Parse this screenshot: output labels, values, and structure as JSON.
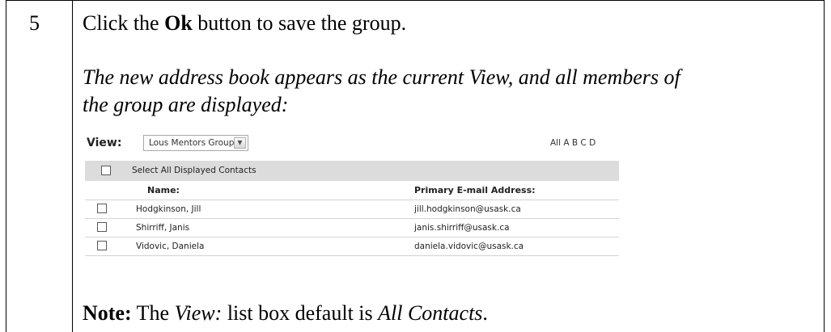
{
  "step": {
    "number": "5",
    "instruction": {
      "before": "Click the ",
      "bold": "Ok",
      "after": " button to save the group."
    },
    "description_line1": "The new address book appears as the current View, and all members of",
    "description_line2": "the group are displayed:",
    "note": {
      "label": "Note:",
      "pre": " The ",
      "italic1": "View:",
      "mid": " list box default is ",
      "italic2": "All Contacts",
      "post": "."
    }
  },
  "screenshot": {
    "view_label": "View:",
    "view_selected": "Lous Mentors Group",
    "alpha_filter": "All A B C D",
    "select_all_label": "Select All Displayed Contacts",
    "columns": {
      "name": "Name:",
      "email": "Primary E-mail Address:"
    },
    "contacts": [
      {
        "name": "Hodgkinson, Jill",
        "email": "jill.hodgkinson@usask.ca"
      },
      {
        "name": "Shirriff, Janis",
        "email": "janis.shirriff@usask.ca"
      },
      {
        "name": "Vidovic, Daniela",
        "email": "daniela.vidovic@usask.ca"
      }
    ]
  }
}
